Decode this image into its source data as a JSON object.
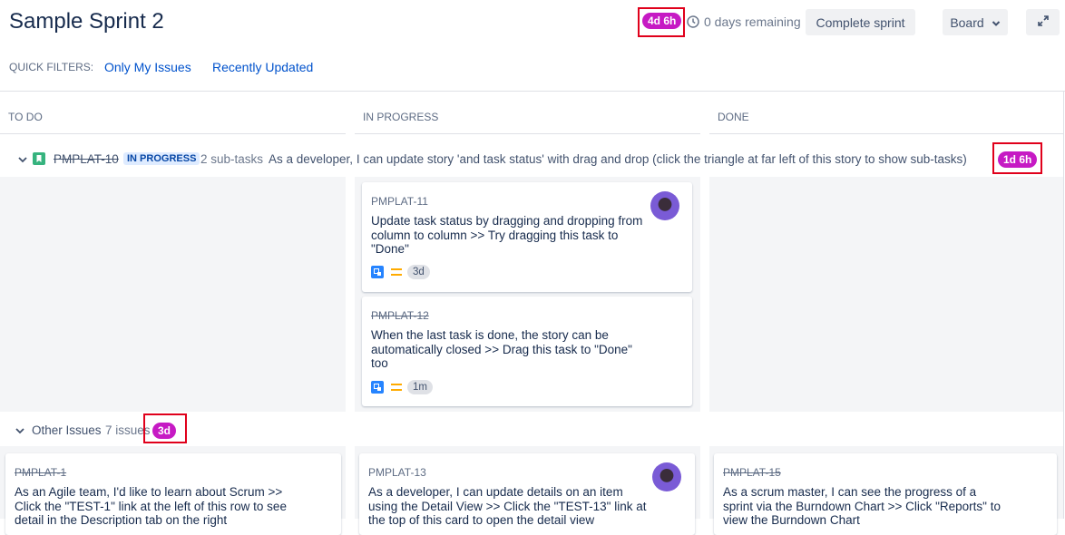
{
  "header": {
    "title": "Sample Sprint 2",
    "time_badge": "4d 6h",
    "days_remaining": "0 days remaining",
    "complete_sprint": "Complete sprint",
    "board_label": "Board"
  },
  "quick_filters": {
    "label": "QUICK FILTERS:",
    "items": [
      "Only My Issues",
      "Recently Updated"
    ]
  },
  "columns": [
    "TO DO",
    "IN PROGRESS",
    "DONE"
  ],
  "swimlane": {
    "key": "PMPLAT-10",
    "status": "IN PROGRESS",
    "subtasks": "2 sub-tasks",
    "summary": "As a developer, I can update story 'and task status' with drag and drop (click the triangle at far left of this story to show sub-tasks)",
    "badge": "1d 6h"
  },
  "cards_in_progress": [
    {
      "key": "PMPLAT-11",
      "summary": "Update task status by dragging and dropping from column to column >> Try dragging this task to \"Done\"",
      "estimate": "3d"
    },
    {
      "key": "PMPLAT-12",
      "summary": "When the last task is done, the story can be automatically closed >> Drag this task to \"Done\" too",
      "estimate": "1m"
    }
  ],
  "other_issues": {
    "label": "Other Issues",
    "count": "7 issues",
    "badge": "3d"
  },
  "bottom_cards": [
    {
      "key": "PMPLAT-1",
      "summary": "As an Agile team, I'd like to learn about Scrum >> Click the \"TEST-1\" link at the left of this row to see detail in the Description tab on the right"
    },
    {
      "key": "PMPLAT-13",
      "summary": "As a developer, I can update details on an item using the Detail View >> Click the \"TEST-13\" link at the top of this card to open the detail view"
    },
    {
      "key": "PMPLAT-15",
      "summary": "As a scrum master, I can see the progress of a sprint via the Burndown Chart >> Click \"Reports\" to view the Burndown Chart"
    }
  ]
}
